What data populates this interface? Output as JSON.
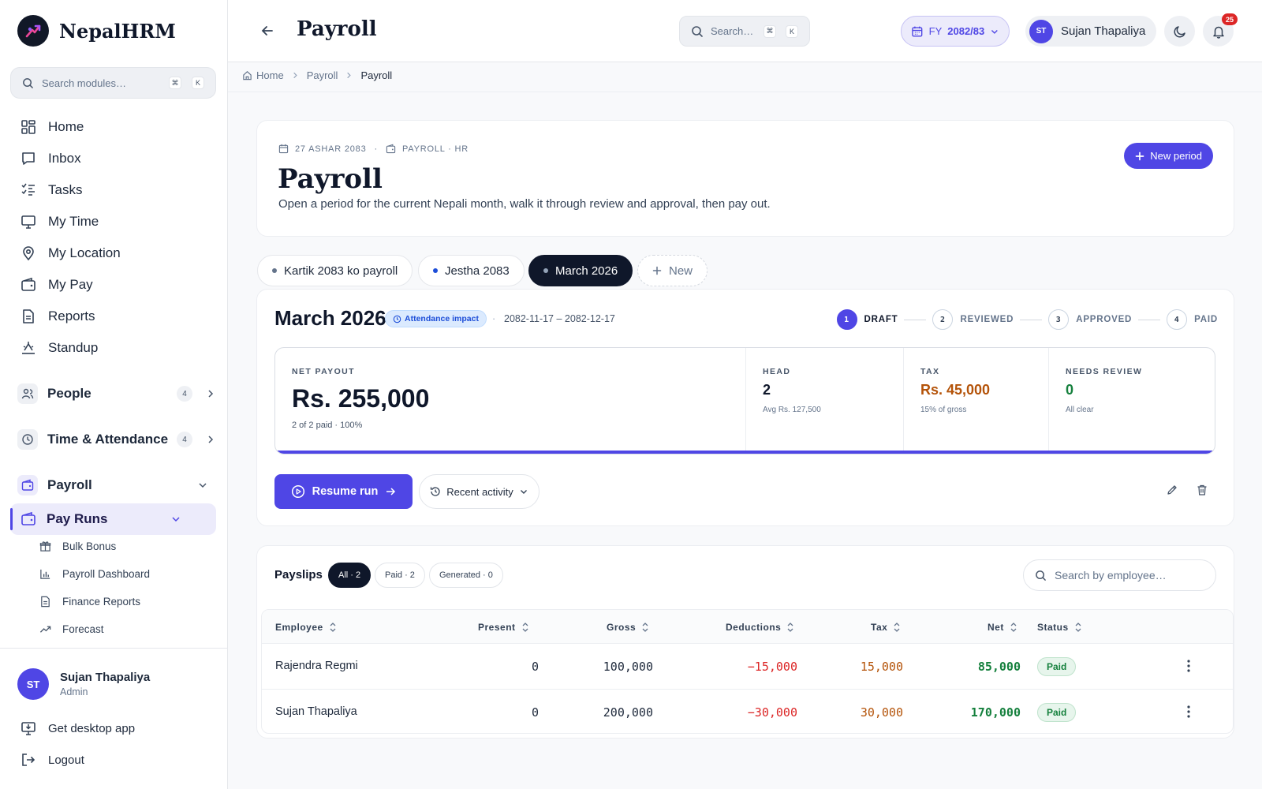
{
  "app": {
    "name": "NepalHRM"
  },
  "sidebar": {
    "search_placeholder": "Search modules…",
    "shortcut": [
      "⌘",
      "K"
    ],
    "nav": [
      {
        "label": "Home",
        "icon": "grid-icon"
      },
      {
        "label": "Inbox",
        "icon": "message-icon"
      },
      {
        "label": "Tasks",
        "icon": "list-check-icon"
      },
      {
        "label": "My Time",
        "icon": "monitor-icon"
      },
      {
        "label": "My Location",
        "icon": "map-pin-icon"
      },
      {
        "label": "My Pay",
        "icon": "wallet-icon"
      },
      {
        "label": "Reports",
        "icon": "file-icon"
      },
      {
        "label": "Standup",
        "icon": "standup-icon"
      }
    ],
    "groups": {
      "people": {
        "label": "People",
        "count": "4"
      },
      "time": {
        "label": "Time & Attendance",
        "count": "4"
      },
      "payroll": {
        "label": "Payroll"
      }
    },
    "payruns": {
      "label": "Pay Runs"
    },
    "sub": [
      {
        "label": "Bulk Bonus",
        "icon": "gift-icon"
      },
      {
        "label": "Payroll Dashboard",
        "icon": "bar-chart-icon"
      },
      {
        "label": "Finance Reports",
        "icon": "document-icon"
      },
      {
        "label": "Forecast",
        "icon": "trending-up-icon"
      }
    ],
    "user": {
      "initials": "ST",
      "name": "Sujan Thapaliya",
      "role": "Admin"
    },
    "desktop_app": "Get desktop app",
    "logout": "Logout"
  },
  "topbar": {
    "title": "Payroll",
    "search_placeholder": "Search…",
    "shortcut": [
      "⌘",
      "K"
    ],
    "fy_prefix": "FY",
    "fy_value": "2082/83",
    "user_initials": "ST",
    "user_name": "Sujan Thapaliya",
    "notification_count": "25"
  },
  "breadcrumb": {
    "home": "Home",
    "section": "Payroll",
    "current": "Payroll"
  },
  "header": {
    "date": "27 ASHAR 2083",
    "separator": "·",
    "context": "PAYROLL · HR",
    "title": "Payroll",
    "description": "Open a period for the current Nepali month, walk it through review and approval, then pay out.",
    "new_period": "New period"
  },
  "tabs": [
    {
      "label": "Kartik 2083 ko payroll",
      "dot": "#64748b"
    },
    {
      "label": "Jestha 2083",
      "dot": "#1d4ed8"
    },
    {
      "label": "March 2026",
      "dot": "#94a3b8"
    },
    {
      "label": "New"
    }
  ],
  "period": {
    "title": "March 2026",
    "badge": "Attendance impact",
    "separator": "·",
    "range": "2082-11-17 – 2082-12-17",
    "steps": [
      {
        "num": "1",
        "label": "DRAFT"
      },
      {
        "num": "2",
        "label": "REVIEWED"
      },
      {
        "num": "3",
        "label": "APPROVED"
      },
      {
        "num": "4",
        "label": "PAID"
      }
    ],
    "current_step": 1,
    "net_payout_label": "NET PAYOUT",
    "net_payout": "Rs. 255,000",
    "net_payout_sub": "2 of 2 paid · 100%",
    "paid_fraction": 1.0,
    "head_label": "HEAD",
    "head": "2",
    "head_sub": "Avg Rs. 127,500",
    "tax_label": "TAX",
    "tax": "Rs. 45,000",
    "tax_sub": "15% of gross",
    "review_label": "NEEDS REVIEW",
    "review": "0",
    "review_sub": "All clear",
    "resume": "Resume run",
    "activity": "Recent activity"
  },
  "payslips": {
    "title": "Payslips",
    "chips": [
      "All · 2",
      "Paid · 2",
      "Generated · 0"
    ],
    "search_placeholder": "Search by employee…",
    "columns": [
      "Employee",
      "Present",
      "Gross",
      "Deductions",
      "Tax",
      "Net",
      "Status"
    ],
    "rows": [
      {
        "employee": "Rajendra Regmi",
        "present": "0",
        "gross": "100,000",
        "deductions": "−15,000",
        "tax": "15,000",
        "net": "85,000",
        "status": "Paid"
      },
      {
        "employee": "Sujan Thapaliya",
        "present": "0",
        "gross": "200,000",
        "deductions": "−30,000",
        "tax": "30,000",
        "net": "170,000",
        "status": "Paid"
      }
    ]
  },
  "colors": {
    "accent": "#4f46e5",
    "positive": "#15803d",
    "negative": "#dc2626",
    "tax": "#b45309"
  }
}
